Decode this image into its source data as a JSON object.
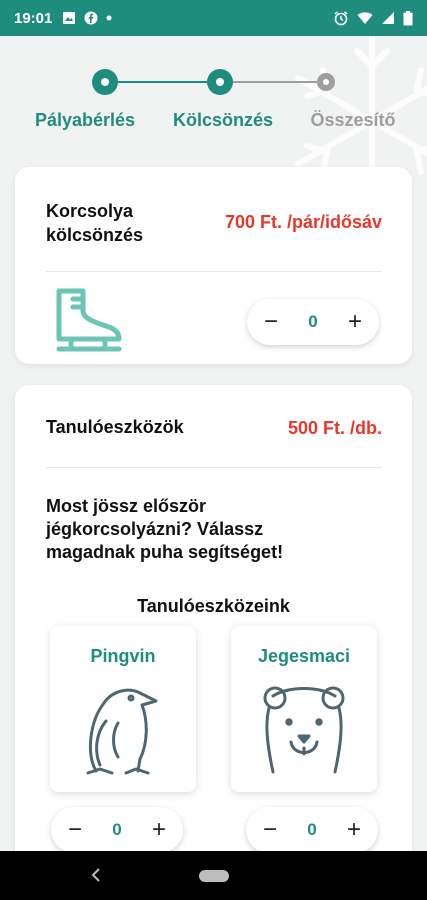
{
  "status_bar": {
    "time": "19:01",
    "bg_color": "#1f8d7e"
  },
  "stepper": {
    "steps": [
      {
        "label": "Pályabérlés",
        "state": "done"
      },
      {
        "label": "Kölcsönzés",
        "state": "current"
      },
      {
        "label": "Összesítő",
        "state": "pending"
      }
    ],
    "active_color": "#1f8d7e",
    "inactive_color": "#9e9e9e"
  },
  "skate_card": {
    "title_line1": "Korcsolya",
    "title_line2": "kölcsönzés",
    "price": "700 Ft. /pár/idősáv",
    "quantity": "0",
    "icon": "skate-icon"
  },
  "tools_card": {
    "title": "Tanulóeszközök",
    "price": "500 Ft. /db.",
    "prompt_line1": "Most jössz először",
    "prompt_line2": "jégkorcsolyázni? Válassz",
    "prompt_line3": "magadnak puha segítséget!",
    "section_title": "Tanulóeszközeink",
    "items": [
      {
        "name": "Pingvin",
        "quantity": "0",
        "icon": "penguin-icon"
      },
      {
        "name": "Jegesmaci",
        "quantity": "0",
        "icon": "bear-icon"
      }
    ]
  },
  "qty_controls": {
    "minus": "−",
    "plus": "+"
  },
  "colors": {
    "accent": "#1f8d7e",
    "price": "#e8382b"
  }
}
